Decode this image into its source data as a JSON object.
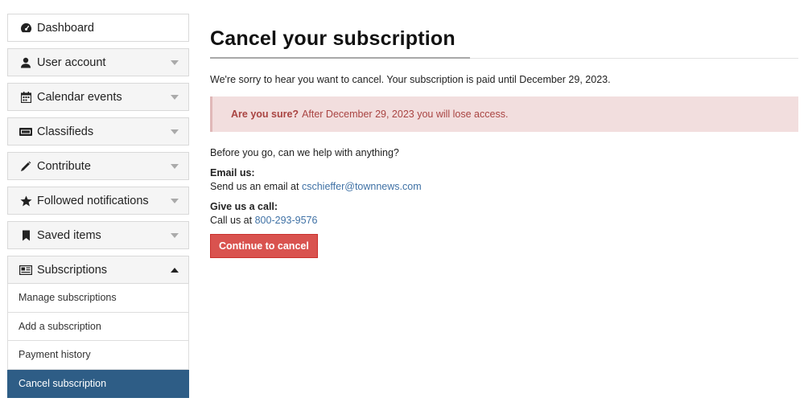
{
  "sidebar": {
    "items": [
      {
        "label": "Dashboard",
        "icon": "dashboard-icon"
      },
      {
        "label": "User account",
        "icon": "user-icon"
      },
      {
        "label": "Calendar events",
        "icon": "calendar-icon"
      },
      {
        "label": "Classifieds",
        "icon": "classifieds-icon"
      },
      {
        "label": "Contribute",
        "icon": "pencil-icon"
      },
      {
        "label": "Followed notifications",
        "icon": "star-icon"
      },
      {
        "label": "Saved items",
        "icon": "bookmark-icon"
      },
      {
        "label": "Subscriptions",
        "icon": "newspaper-icon"
      }
    ],
    "subscriptions": [
      {
        "label": "Manage subscriptions"
      },
      {
        "label": "Add a subscription"
      },
      {
        "label": "Payment history"
      },
      {
        "label": "Cancel subscription",
        "active": true
      }
    ]
  },
  "main": {
    "title": "Cancel your subscription",
    "intro": "We're sorry to hear you want to cancel. Your subscription is paid until December 29, 2023.",
    "alert": {
      "strong": "Are you sure?",
      "text": "After December 29, 2023 you will lose access."
    },
    "help": "Before you go, can we help with anything?",
    "email": {
      "label": "Email us:",
      "prefix": "Send us an email at",
      "address": "cschieffer@townnews.com"
    },
    "call": {
      "label": "Give us a call:",
      "prefix": "Call us at",
      "phone": "800-293-9576"
    },
    "button": "Continue to cancel"
  },
  "colors": {
    "active_nav": "#2e5d86",
    "alert_bg": "#f2dede",
    "alert_text": "#a94442",
    "button": "#d9534f",
    "link": "#3f71a5"
  }
}
